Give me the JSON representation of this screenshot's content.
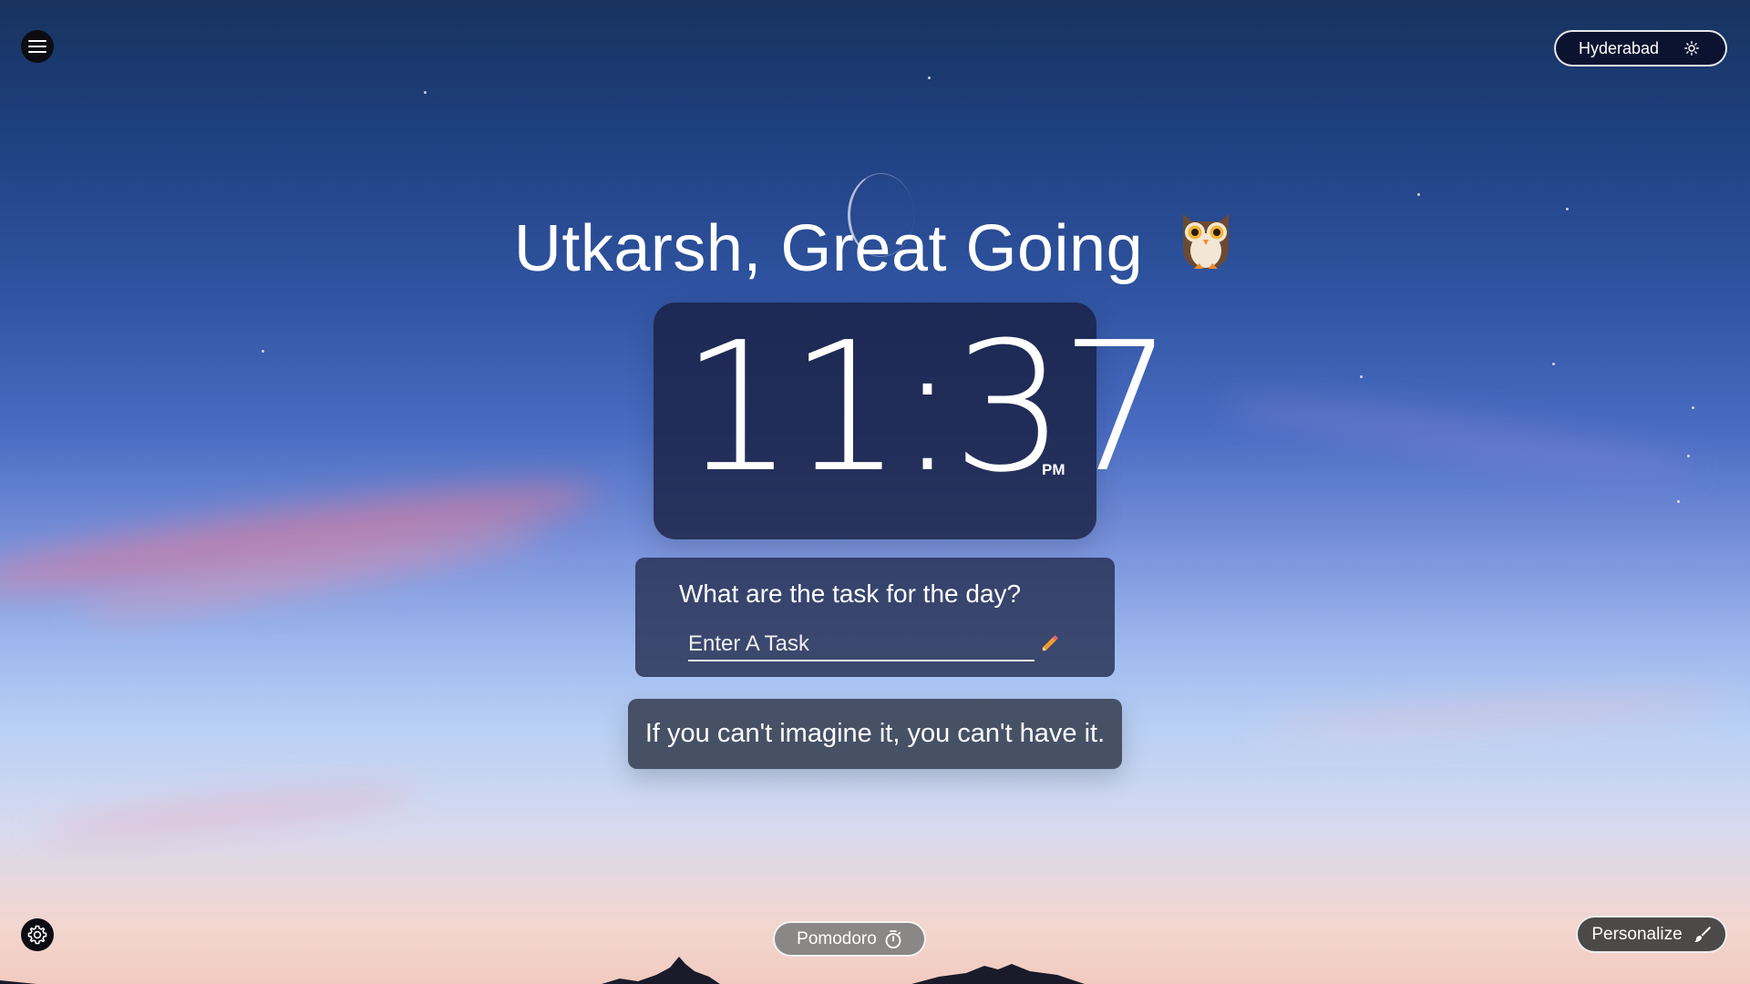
{
  "greeting": {
    "text": "Utkarsh, Great Going",
    "emoji_icon": "owl-icon"
  },
  "weather": {
    "city": "Hyderabad",
    "icon": "sun-icon"
  },
  "clock": {
    "time": "11:37",
    "ampm": "PM"
  },
  "task": {
    "prompt": "What are the task for the day?",
    "placeholder": "Enter A Task",
    "edit_icon": "pencil-icon"
  },
  "quote": {
    "text": "If you can't imagine it, you can't have it."
  },
  "footer": {
    "pomodoro_label": "Pomodoro",
    "pomodoro_icon": "stopwatch-icon",
    "personalize_label": "Personalize",
    "personalize_icon": "paintbrush-icon"
  },
  "colors": {
    "card_bg": "#182042",
    "task_card_bg": "#242e52",
    "quote_card_bg": "#3a4256",
    "pomodoro_bg": "#8a8886",
    "personalize_bg": "#4b4a48",
    "weather_pill_bg": "#0b1330"
  }
}
